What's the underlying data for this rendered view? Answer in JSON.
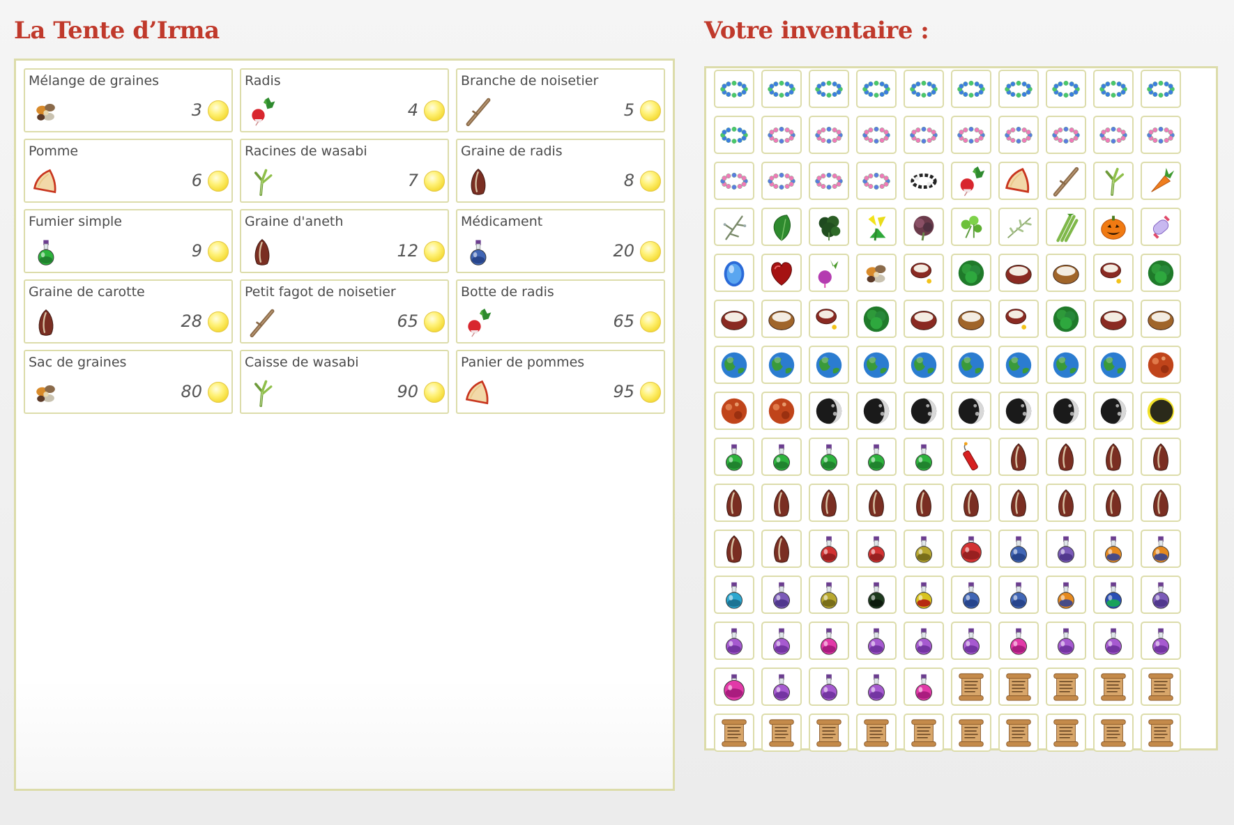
{
  "shop": {
    "title": "La Tente d’Irma",
    "items": [
      {
        "name": "Mélange de graines",
        "price": "3",
        "icon": "seed-mix-icon"
      },
      {
        "name": "Radis",
        "price": "4",
        "icon": "radish-icon"
      },
      {
        "name": "Branche de noisetier",
        "price": "5",
        "icon": "branch-icon"
      },
      {
        "name": "Pomme",
        "price": "6",
        "icon": "apple-icon"
      },
      {
        "name": "Racines de wasabi",
        "price": "7",
        "icon": "wasabi-icon"
      },
      {
        "name": "Graine de radis",
        "price": "8",
        "icon": "seed-icon"
      },
      {
        "name": "Fumier simple",
        "price": "9",
        "icon": "potion-green-icon"
      },
      {
        "name": "Graine d'aneth",
        "price": "12",
        "icon": "seed-icon"
      },
      {
        "name": "Médicament",
        "price": "20",
        "icon": "potion-blue-icon"
      },
      {
        "name": "Graine de carotte",
        "price": "28",
        "icon": "seed-icon"
      },
      {
        "name": "Petit fagot de noisetier",
        "price": "65",
        "icon": "branch-icon"
      },
      {
        "name": "Botte de radis",
        "price": "65",
        "icon": "radish-icon"
      },
      {
        "name": "Sac de graines",
        "price": "80",
        "icon": "seed-mix-icon"
      },
      {
        "name": "Caisse de wasabi",
        "price": "90",
        "icon": "wasabi-icon"
      },
      {
        "name": "Panier de pommes",
        "price": "95",
        "icon": "apple-icon"
      }
    ]
  },
  "inventory": {
    "title": "Votre inventaire :",
    "slots": [
      "bracelet-blue-icon",
      "bracelet-blue-icon",
      "bracelet-blue-icon",
      "bracelet-blue-icon",
      "bracelet-blue-icon",
      "bracelet-blue-icon",
      "bracelet-blue-icon",
      "bracelet-blue-icon",
      "bracelet-blue-icon",
      "bracelet-blue-icon",
      "bracelet-blue-icon",
      "bracelet-pink-icon",
      "bracelet-pink-icon",
      "bracelet-pink-icon",
      "bracelet-pink-icon",
      "bracelet-pink-icon",
      "bracelet-pink-icon",
      "bracelet-pink-icon",
      "bracelet-pink-icon",
      "bracelet-pink-icon",
      "bracelet-pink-icon",
      "bracelet-pink-icon",
      "bracelet-pink-icon",
      "bracelet-pink-icon",
      "bracelet-black-icon",
      "radish-icon",
      "apple-icon",
      "branch-icon",
      "wasabi-icon",
      "carrot-icon",
      "twig-icon",
      "spinach-icon",
      "kale-icon",
      "yellow-flower-icon",
      "lettuce-red-icon",
      "parsley-icon",
      "herb-icon",
      "celery-icon",
      "pumpkin-icon",
      "candy-icon",
      "blue-egg-icon",
      "heart-icon",
      "turnip-icon",
      "seed-mix-icon",
      "bowl-egg-icon",
      "cabbage-icon",
      "bowl-red-icon",
      "bowl-brown-icon",
      "bowl-egg-icon",
      "cabbage-icon",
      "bowl-red-icon",
      "bowl-brown-icon",
      "bowl-egg-icon",
      "cabbage-icon",
      "bowl-red-icon",
      "bowl-brown-icon",
      "bowl-egg-icon",
      "cabbage-icon",
      "bowl-red-icon",
      "bowl-brown-icon",
      "earth-icon",
      "earth-icon",
      "earth-icon",
      "earth-icon",
      "earth-icon",
      "earth-icon",
      "earth-icon",
      "earth-icon",
      "earth-icon",
      "mars-icon",
      "mars-icon",
      "mars-icon",
      "moon-icon",
      "moon-icon",
      "moon-icon",
      "moon-icon",
      "moon-icon",
      "moon-icon",
      "moon-icon",
      "eclipse-icon",
      "potion-green-icon",
      "potion-green-icon",
      "potion-green-icon",
      "potion-green-icon",
      "potion-green-icon",
      "dynamite-icon",
      "seed-icon",
      "seed-icon",
      "seed-icon",
      "seed-icon",
      "seed-icon",
      "seed-icon",
      "seed-icon",
      "seed-icon",
      "seed-icon",
      "seed-icon",
      "seed-icon",
      "seed-icon",
      "seed-icon",
      "seed-icon",
      "seed-icon",
      "seed-icon",
      "potion-red-icon",
      "potion-red-icon",
      "potion-olive-icon",
      "potion-redbig-icon",
      "potion-blue-icon",
      "potion-purple-icon",
      "potion-orange-icon",
      "potion-orange-icon",
      "potion-cyan-icon",
      "potion-purple-icon",
      "potion-olive-icon",
      "potion-black-icon",
      "potion-redblack-icon",
      "potion-blue-icon",
      "potion-blue-icon",
      "potion-orange-icon",
      "potion-rainbow-icon",
      "potion-purple-icon",
      "potion-violet-icon",
      "potion-violet-icon",
      "potion-pink-icon",
      "potion-violet-icon",
      "potion-violet-icon",
      "potion-violet-icon",
      "potion-pink-icon",
      "potion-violet-icon",
      "potion-violet-icon",
      "potion-violet-icon",
      "potion-pinkbig-icon",
      "potion-violet-icon",
      "potion-violet-icon",
      "potion-violet-icon",
      "potion-pink-icon",
      "scroll-icon",
      "scroll-icon",
      "scroll-icon",
      "scroll-icon",
      "scroll-icon",
      "scroll-icon",
      "scroll-icon",
      "scroll-icon",
      "scroll-icon",
      "scroll-icon",
      "scroll-icon",
      "scroll-icon",
      "scroll-icon",
      "scroll-icon",
      "scroll-icon"
    ]
  }
}
